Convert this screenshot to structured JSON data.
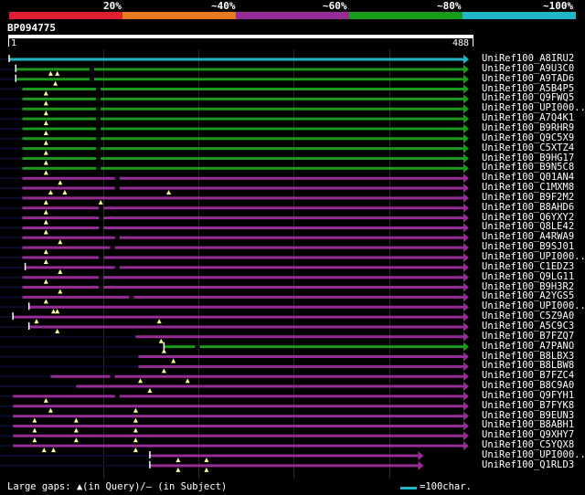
{
  "identity_scale": {
    "labels": [
      "20%",
      "~40%",
      "~60%",
      "~80%",
      "~100%"
    ],
    "colors": [
      "#e0202e",
      "#ea7a1e",
      "#962d96",
      "#1a9a1a",
      "#1fb6c8"
    ]
  },
  "query": {
    "id": "BP094775",
    "start": "1",
    "end": "488",
    "length": 488
  },
  "hits": [
    {
      "name": "UniRef100_A8IRU2",
      "color": "#1fb6c8",
      "start": 1,
      "end": 488,
      "fs": 1,
      "q": [],
      "hs": []
    },
    {
      "name": "UniRef100_A9U3C0",
      "color": "#1a9a1a",
      "start": 8,
      "end": 488,
      "fs": 1,
      "q": [
        45,
        52
      ],
      "hs": [
        88
      ]
    },
    {
      "name": "UniRef100_A9TAD6",
      "color": "#1a9a1a",
      "start": 8,
      "end": 488,
      "fs": 1,
      "q": [
        50
      ],
      "hs": [
        88
      ]
    },
    {
      "name": "UniRef100_A5B4P5",
      "color": "#1a9a1a",
      "start": 15,
      "end": 488,
      "fs": 0,
      "q": [
        40
      ],
      "hs": [
        95
      ]
    },
    {
      "name": "UniRef100_Q9FWQ5",
      "color": "#1a9a1a",
      "start": 15,
      "end": 488,
      "fs": 0,
      "q": [
        40
      ],
      "hs": [
        95
      ]
    },
    {
      "name": "UniRef100_UPI000..",
      "color": "#1a9a1a",
      "start": 15,
      "end": 488,
      "fs": 0,
      "q": [
        40
      ],
      "hs": [
        95
      ]
    },
    {
      "name": "UniRef100_A7Q4K1",
      "color": "#1a9a1a",
      "start": 15,
      "end": 488,
      "fs": 0,
      "q": [
        40
      ],
      "hs": [
        95
      ]
    },
    {
      "name": "UniRef100_B9RHR9",
      "color": "#1a9a1a",
      "start": 15,
      "end": 488,
      "fs": 0,
      "q": [
        40
      ],
      "hs": [
        95
      ]
    },
    {
      "name": "UniRef100_Q9C5X9",
      "color": "#1a9a1a",
      "start": 15,
      "end": 488,
      "fs": 0,
      "q": [
        40
      ],
      "hs": [
        95
      ]
    },
    {
      "name": "UniRef100_C5XTZ4",
      "color": "#1a9a1a",
      "start": 15,
      "end": 488,
      "fs": 0,
      "q": [
        40
      ],
      "hs": [
        95
      ]
    },
    {
      "name": "UniRef100_B9HG17",
      "color": "#1a9a1a",
      "start": 15,
      "end": 488,
      "fs": 0,
      "q": [
        40
      ],
      "hs": [
        95
      ]
    },
    {
      "name": "UniRef100_B9N5C8",
      "color": "#1a9a1a",
      "start": 15,
      "end": 488,
      "fs": 0,
      "q": [
        40
      ],
      "hs": [
        95
      ]
    },
    {
      "name": "UniRef100_Q01AN4",
      "color": "#962d96",
      "start": 15,
      "end": 488,
      "fs": 0,
      "q": [
        55
      ],
      "hs": [
        115
      ]
    },
    {
      "name": "UniRef100_C1MXM8",
      "color": "#962d96",
      "start": 15,
      "end": 488,
      "fs": 0,
      "q": [
        45,
        60,
        170
      ],
      "hs": [
        115
      ]
    },
    {
      "name": "UniRef100_B9F2M2",
      "color": "#962d96",
      "start": 15,
      "end": 488,
      "fs": 0,
      "q": [
        40,
        98
      ],
      "hs": []
    },
    {
      "name": "UniRef100_B8AHD6",
      "color": "#962d96",
      "start": 15,
      "end": 488,
      "fs": 0,
      "q": [
        40
      ],
      "hs": [
        98
      ]
    },
    {
      "name": "UniRef100_Q6YXY2",
      "color": "#962d96",
      "start": 15,
      "end": 488,
      "fs": 0,
      "q": [
        40
      ],
      "hs": [
        98
      ]
    },
    {
      "name": "UniRef100_Q8LE42",
      "color": "#962d96",
      "start": 15,
      "end": 488,
      "fs": 0,
      "q": [
        40
      ],
      "hs": [
        98
      ]
    },
    {
      "name": "UniRef100_A4RWA9",
      "color": "#962d96",
      "start": 15,
      "end": 488,
      "fs": 0,
      "q": [
        55
      ],
      "hs": [
        115
      ]
    },
    {
      "name": "UniRef100_B9SJ01",
      "color": "#962d96",
      "start": 15,
      "end": 488,
      "fs": 0,
      "q": [
        40
      ],
      "hs": [
        110
      ]
    },
    {
      "name": "UniRef100_UPI000..",
      "color": "#962d96",
      "start": 15,
      "end": 488,
      "fs": 0,
      "q": [
        40
      ],
      "hs": [
        98
      ]
    },
    {
      "name": "UniRef100_C1EDZ3",
      "color": "#962d96",
      "start": 18,
      "end": 488,
      "fs": 1,
      "q": [
        55
      ],
      "hs": [
        115
      ]
    },
    {
      "name": "UniRef100_Q9LG11",
      "color": "#962d96",
      "start": 15,
      "end": 488,
      "fs": 0,
      "q": [
        40
      ],
      "hs": [
        98
      ]
    },
    {
      "name": "UniRef100_B9H3R2",
      "color": "#962d96",
      "start": 15,
      "end": 488,
      "fs": 0,
      "q": [
        55
      ],
      "hs": [
        98
      ]
    },
    {
      "name": "UniRef100_A2YGS5",
      "color": "#962d96",
      "start": 15,
      "end": 488,
      "fs": 0,
      "q": [
        40
      ],
      "hs": [
        130
      ]
    },
    {
      "name": "UniRef100_UPI000..",
      "color": "#962d96",
      "start": 22,
      "end": 488,
      "fs": 1,
      "q": [
        48,
        52
      ],
      "hs": []
    },
    {
      "name": "UniRef100_C5Z9A0",
      "color": "#962d96",
      "start": 5,
      "end": 488,
      "fs": 1,
      "q": [
        30,
        160
      ],
      "hs": []
    },
    {
      "name": "UniRef100_A5C9C3",
      "color": "#962d96",
      "start": 22,
      "end": 488,
      "fs": 1,
      "q": [
        52
      ],
      "hs": []
    },
    {
      "name": "UniRef100_B7FZQ7",
      "color": "#962d96",
      "start": 135,
      "end": 488,
      "fs": 0,
      "q": [
        162
      ],
      "hs": []
    },
    {
      "name": "UniRef100_A7PANO",
      "color": "#1a9a1a",
      "start": 165,
      "end": 488,
      "fs": 1,
      "q": [
        165
      ],
      "hs": [
        200
      ]
    },
    {
      "name": "UniRef100_B8LBX3",
      "color": "#962d96",
      "start": 138,
      "end": 488,
      "fs": 0,
      "q": [
        175
      ],
      "hs": []
    },
    {
      "name": "UniRef100_B8LBW8",
      "color": "#962d96",
      "start": 138,
      "end": 488,
      "fs": 0,
      "q": [
        165
      ],
      "hs": []
    },
    {
      "name": "UniRef100_B7FZC4",
      "color": "#962d96",
      "start": 45,
      "end": 488,
      "fs": 0,
      "q": [
        140,
        190
      ],
      "hs": [
        110
      ]
    },
    {
      "name": "UniRef100_B8C9A0",
      "color": "#962d96",
      "start": 72,
      "end": 488,
      "fs": 0,
      "q": [
        150
      ],
      "hs": []
    },
    {
      "name": "UniRef100_Q9FYH1",
      "color": "#962d96",
      "start": 5,
      "end": 488,
      "fs": 0,
      "q": [
        40
      ],
      "hs": [
        115
      ]
    },
    {
      "name": "UniRef100_B7FYK8",
      "color": "#962d96",
      "start": 5,
      "end": 488,
      "fs": 0,
      "q": [
        45,
        135
      ],
      "hs": []
    },
    {
      "name": "UniRef100_B9EUN3",
      "color": "#962d96",
      "start": 5,
      "end": 488,
      "fs": 0,
      "q": [
        28,
        72,
        135
      ],
      "hs": []
    },
    {
      "name": "UniRef100_B8ABH1",
      "color": "#962d96",
      "start": 5,
      "end": 488,
      "fs": 0,
      "q": [
        28,
        72,
        135
      ],
      "hs": []
    },
    {
      "name": "UniRef100_Q9XHY7",
      "color": "#962d96",
      "start": 5,
      "end": 488,
      "fs": 0,
      "q": [
        28,
        72,
        135
      ],
      "hs": []
    },
    {
      "name": "UniRef100_C5YQX8",
      "color": "#962d96",
      "start": 5,
      "end": 488,
      "fs": 0,
      "q": [
        38,
        48,
        135
      ],
      "hs": []
    },
    {
      "name": "UniRef100_UPI000..",
      "color": "#962d96",
      "start": 150,
      "end": 440,
      "fs": 1,
      "q": [
        180,
        210
      ],
      "hs": []
    },
    {
      "name": "UniRef100_Q1RLD3",
      "color": "#962d96",
      "start": 150,
      "end": 440,
      "fs": 1,
      "q": [
        180,
        210
      ],
      "hs": []
    }
  ],
  "footer": {
    "gaps_text": "Large gaps: ▲(in Query)/– (in Subject)",
    "legend_text": "=100char."
  }
}
